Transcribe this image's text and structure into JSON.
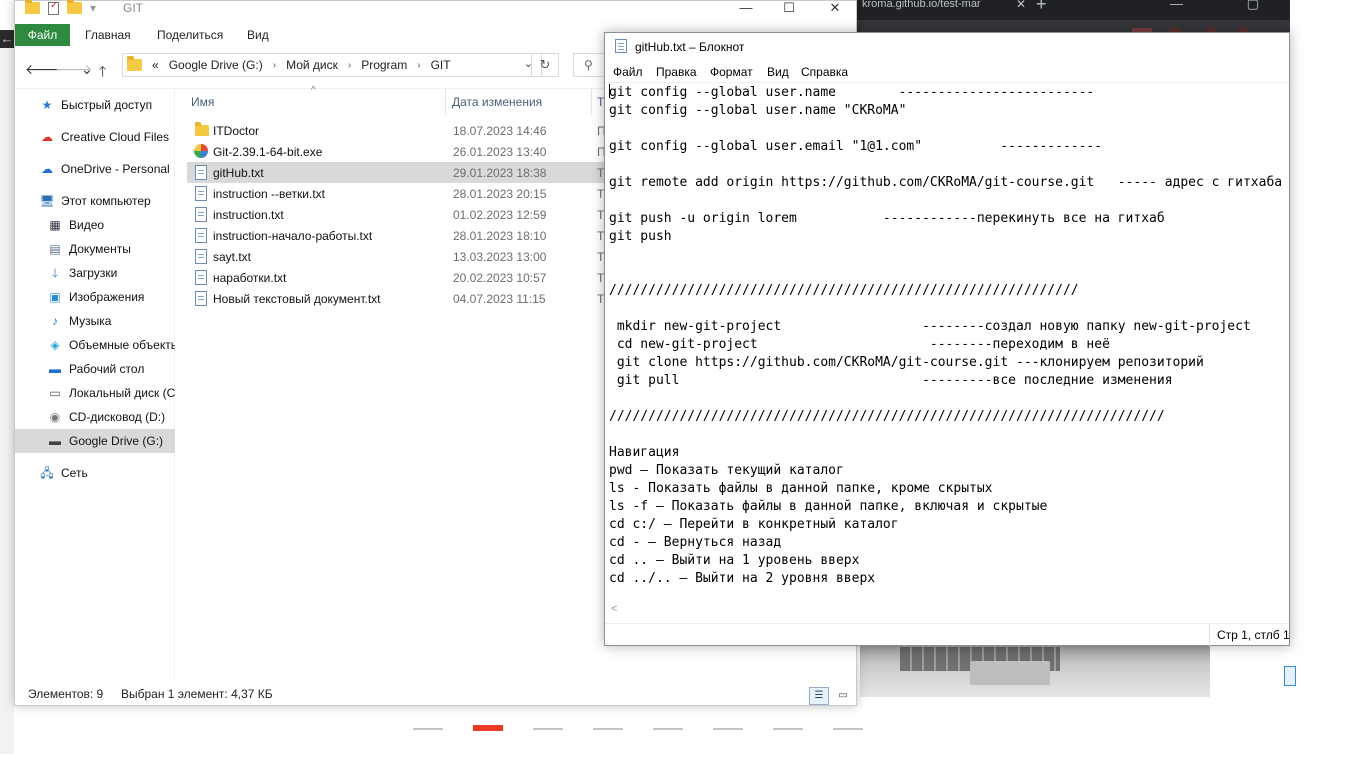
{
  "browser": {
    "tab_title": "kroma.github.io/test-mar",
    "tab_close": "✕",
    "new_tab": "+",
    "window_buttons": "—  ▢  ✕",
    "back_arrow": "←",
    "carousel": {
      "total": 8,
      "active_index": 1
    }
  },
  "explorer": {
    "title": "GIT",
    "window_buttons": {
      "minimize": "—",
      "maximize": "☐",
      "close": "✕"
    },
    "ribbon_tabs": [
      "Файл",
      "Главная",
      "Поделиться",
      "Вид"
    ],
    "nav_buttons": {
      "back": "🡐",
      "forward": "🡒",
      "recent": "⌄",
      "up": "🡑"
    },
    "breadcrumb": {
      "overflow": "«",
      "items": [
        "Google Drive (G:)",
        "Мой диск",
        "Program",
        "GIT"
      ],
      "separator": "›",
      "dropdown": "⌄"
    },
    "refresh_icon": "↻",
    "search_icon": "⚲",
    "nav_pane": [
      {
        "label": "Быстрый доступ",
        "icon": "star-icon",
        "glyph": "★",
        "color": "#2b7bd6",
        "indent": 0
      },
      {
        "label": "Creative Cloud Files",
        "icon": "creative-cloud-icon",
        "glyph": "☁",
        "color": "#d9342b",
        "indent": 0
      },
      {
        "label": "OneDrive - Personal",
        "icon": "onedrive-icon",
        "glyph": "☁",
        "color": "#1f6fd1",
        "indent": 0
      },
      {
        "label": "Этот компьютер",
        "icon": "computer-icon",
        "glyph": "🖥",
        "color": "#2a6fb3",
        "indent": 0
      },
      {
        "label": "Видео",
        "icon": "video-icon",
        "glyph": "▦",
        "color": "#334",
        "indent": 1
      },
      {
        "label": "Документы",
        "icon": "documents-icon",
        "glyph": "▤",
        "color": "#5a6f88",
        "indent": 1
      },
      {
        "label": "Загрузки",
        "icon": "downloads-icon",
        "glyph": "🡓",
        "color": "#2b7bd6",
        "indent": 1
      },
      {
        "label": "Изображения",
        "icon": "pictures-icon",
        "glyph": "▣",
        "color": "#2a8ad1",
        "indent": 1
      },
      {
        "label": "Музыка",
        "icon": "music-icon",
        "glyph": "♪",
        "color": "#2b7bd6",
        "indent": 1
      },
      {
        "label": "Объемные объекты",
        "icon": "3d-objects-icon",
        "glyph": "◈",
        "color": "#27a7d6",
        "indent": 1
      },
      {
        "label": "Рабочий стол",
        "icon": "desktop-icon",
        "glyph": "▬",
        "color": "#1f6fd1",
        "indent": 1
      },
      {
        "label": "Локальный диск (C",
        "icon": "local-disk-icon",
        "glyph": "▭",
        "color": "#555",
        "indent": 1
      },
      {
        "label": "CD-дисковод (D:)",
        "icon": "cd-drive-icon",
        "glyph": "◉",
        "color": "#777",
        "indent": 1
      },
      {
        "label": "Google Drive (G:)",
        "icon": "google-drive-icon",
        "glyph": "▬",
        "color": "#444",
        "indent": 1,
        "selected": true
      },
      {
        "label": "Сеть",
        "icon": "network-icon",
        "glyph": "🖧",
        "color": "#2a6fb3",
        "indent": 0
      }
    ],
    "columns": {
      "name": "Имя",
      "date": "Дата изменения",
      "type": "Т"
    },
    "sort_indicator": "^",
    "files": [
      {
        "name": "ITDoctor",
        "date": "18.07.2023 14:46",
        "type": "П",
        "kind": "folder"
      },
      {
        "name": "Git-2.39.1-64-bit.exe",
        "date": "26.01.2023 13:40",
        "type": "П",
        "kind": "exe"
      },
      {
        "name": "gitHub.txt",
        "date": "29.01.2023 18:38",
        "type": "Т",
        "kind": "txt",
        "selected": true
      },
      {
        "name": "instruction --ветки.txt",
        "date": "28.01.2023 20:15",
        "type": "Т",
        "kind": "txt"
      },
      {
        "name": "instruction.txt",
        "date": "01.02.2023 12:59",
        "type": "Т",
        "kind": "txt"
      },
      {
        "name": "instruction-начало-работы.txt",
        "date": "28.01.2023 18:10",
        "type": "Т",
        "kind": "txt"
      },
      {
        "name": "sayt.txt",
        "date": "13.03.2023 13:00",
        "type": "Те",
        "kind": "txt"
      },
      {
        "name": "наработки.txt",
        "date": "20.02.2023 10:57",
        "type": "Те",
        "kind": "txt"
      },
      {
        "name": "Новый текстовый документ.txt",
        "date": "04.07.2023 11:15",
        "type": "Те",
        "kind": "txt"
      }
    ],
    "status": {
      "count": "Элементов: 9",
      "selection": "Выбран 1 элемент: 4,37 КБ",
      "details_view": "☰",
      "tiles_view": "▭"
    }
  },
  "notepad": {
    "title": "gitHub.txt – Блокнот",
    "menu": [
      "Файл",
      "Правка",
      "Формат",
      "Вид",
      "Справка"
    ],
    "lines": [
      "git config --global user.name        -------------------------",
      "git config --global user.name \"CKRoMA\"",
      "",
      "git config --global user.email \"1@1.com\"          -------------",
      "",
      "git remote add origin https://github.com/CKRoMA/git-course.git   ----- адрес с гитхаба",
      "",
      "git push -u origin lorem           ------------перекинуть все на гитхаб",
      "git push",
      "",
      "",
      "////////////////////////////////////////////////////////////",
      "",
      " mkdir new-git-project                  --------создал новую папку new-git-project",
      " cd new-git-project                      --------переходим в неё",
      " git clone https://github.com/CKRoMA/git-course.git ---клонируем репозиторий",
      " git pull                               ---------все последние изменения",
      "",
      "///////////////////////////////////////////////////////////////////////",
      "",
      "Навигация",
      "pwd — Показать текущий каталог",
      "ls - Показать файлы в данной папке, кроме скрытых",
      "ls -f — Показать файлы в данной папке, включая и скрытые",
      "cd c:/ — Перейти в конкретный каталог",
      "cd - — Вернуться назад",
      "cd .. — Выйти на 1 уровень вверх",
      "cd ../.. — Выйти на 2 уровня вверх"
    ],
    "scroll_left": "<",
    "status_position": "Стр 1, стлб 1"
  }
}
